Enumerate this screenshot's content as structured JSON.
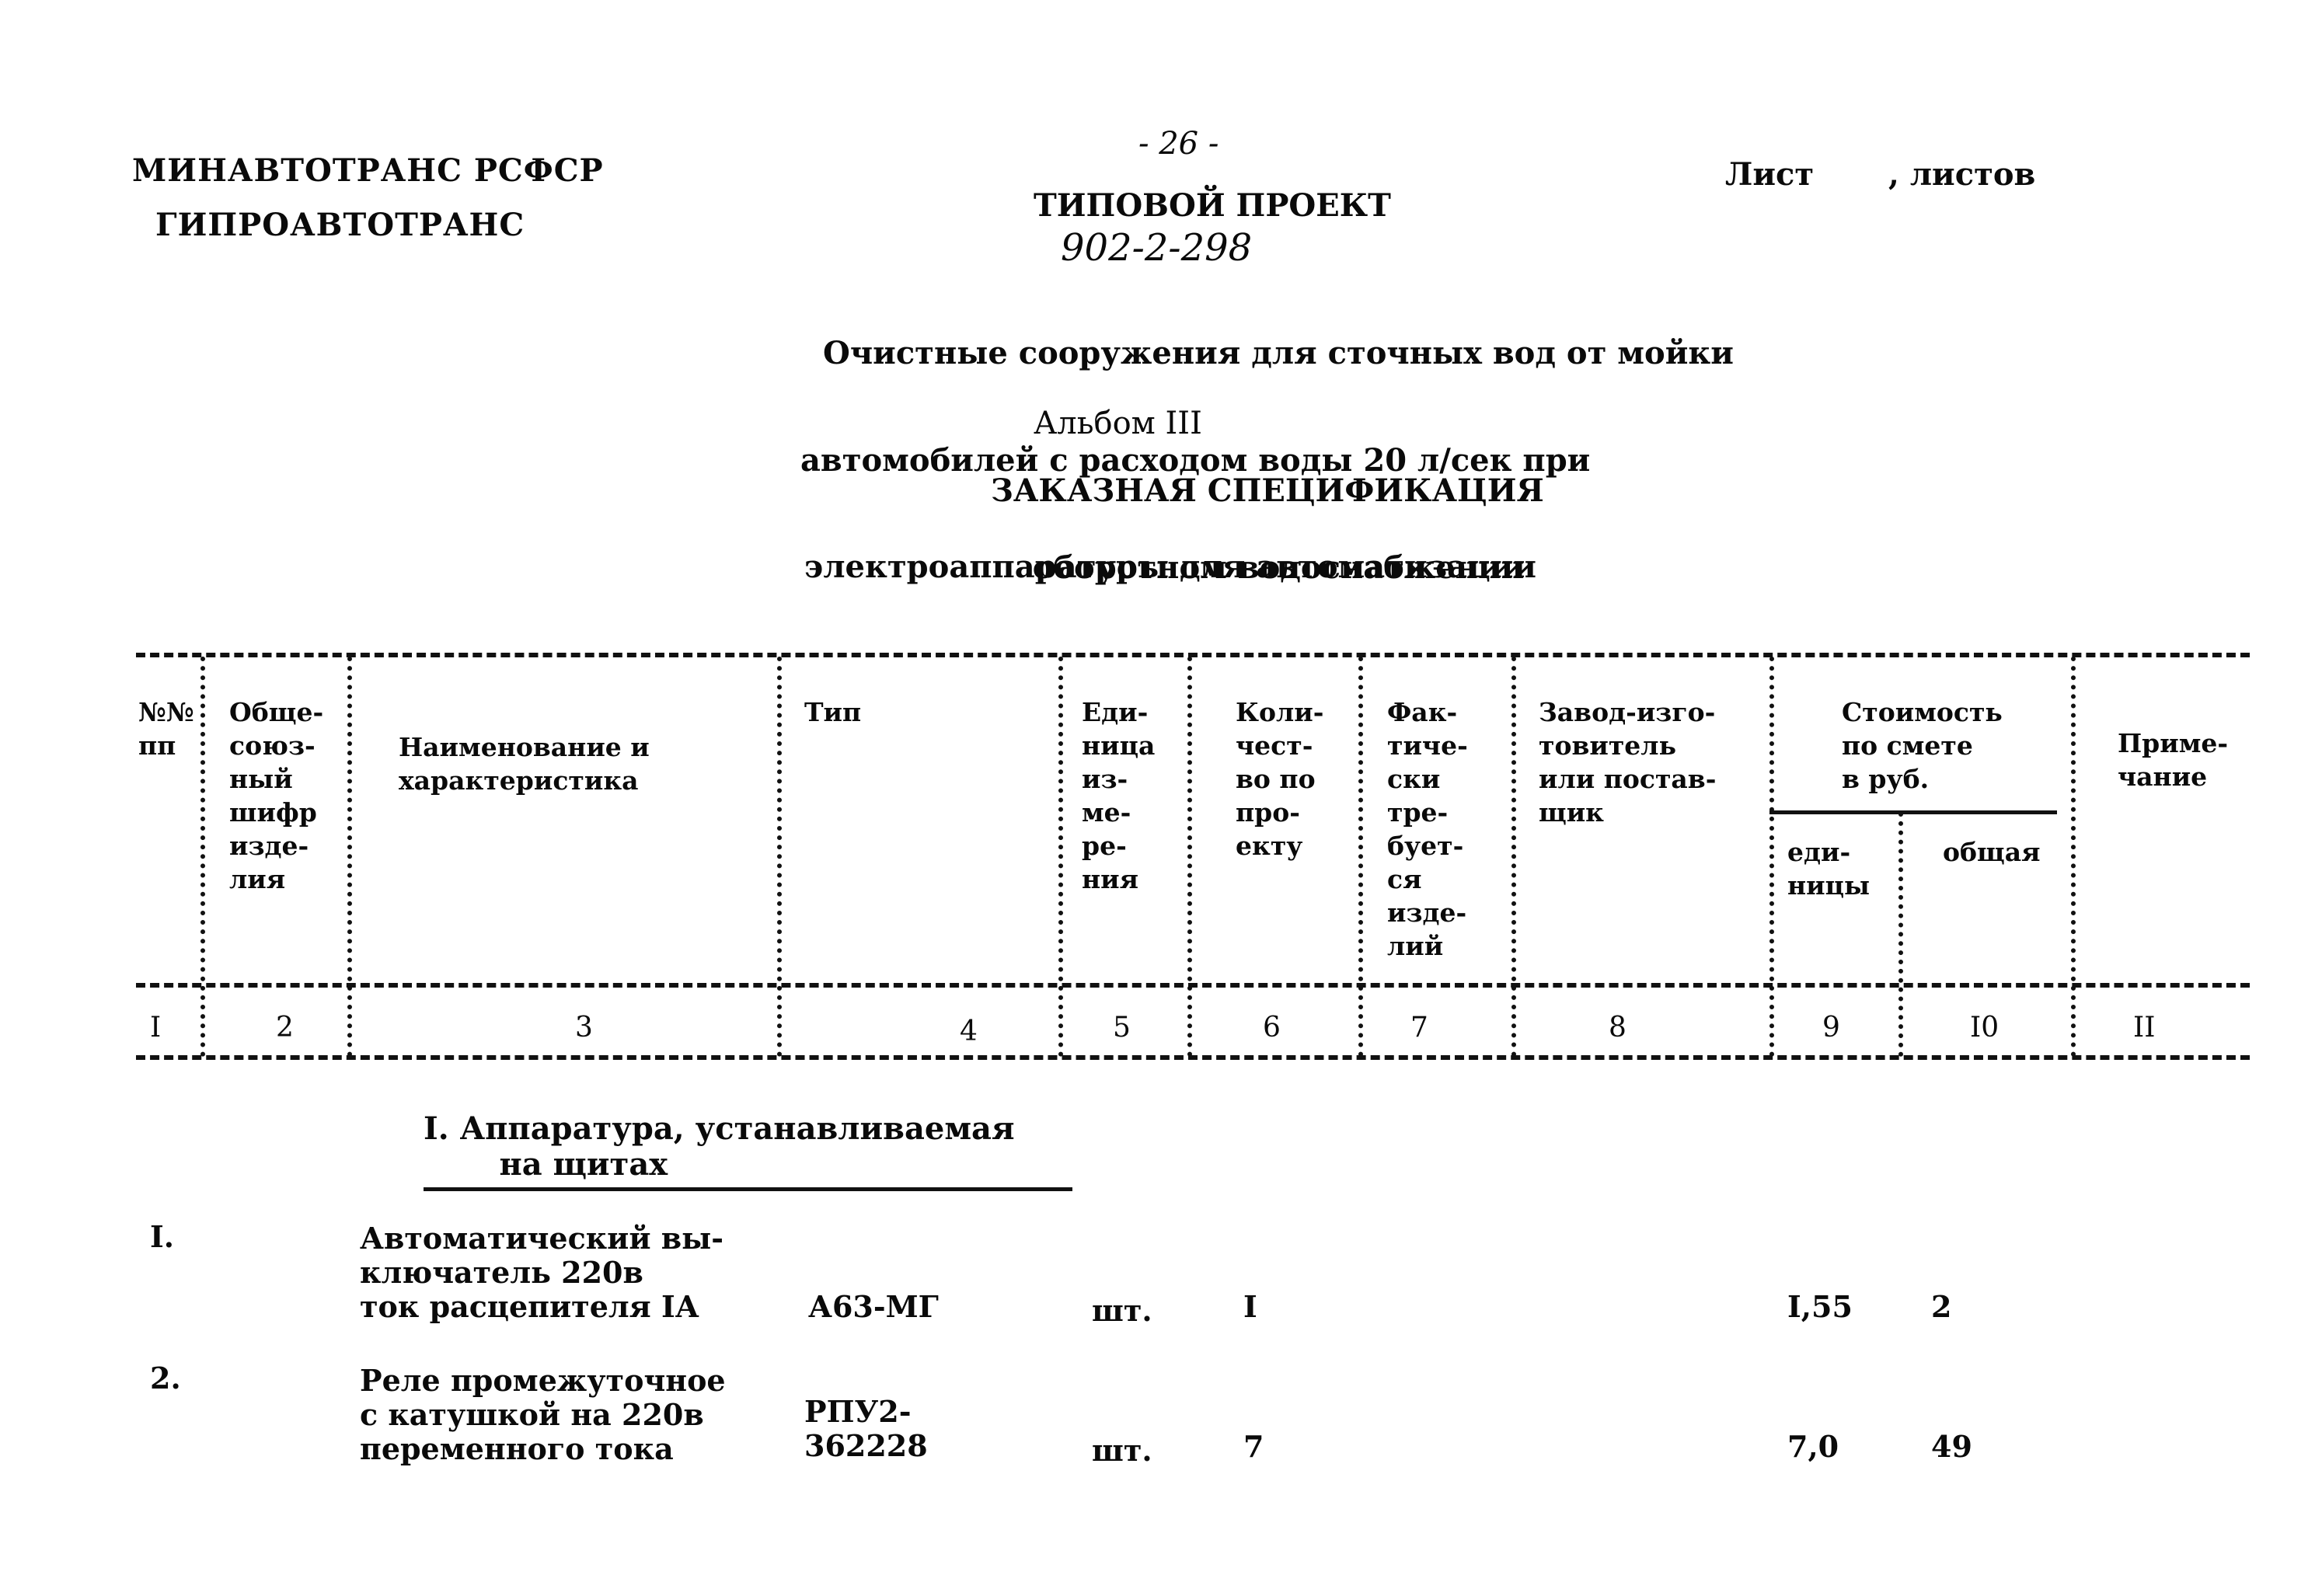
{
  "header": {
    "org_line1": "МИНАВТОТРАНС РСФСР",
    "org_line2": "ГИПРОАВТОТРАНС",
    "page_number": "- 26 -",
    "sheet_label": "Лист",
    "sheets_label": ", листов",
    "project_type": "ТИПОВОЙ ПРОЕКТ",
    "project_number": "902-2-298",
    "description": [
      "Очистные сооружения для сточных вод от мойки",
      "автомобилей с расходом воды 20 л/сек при",
      "оборотном водоснабжении"
    ],
    "album": "Альбом III",
    "doc_title": "ЗАКАЗНАЯ СПЕЦИФИКАЦИЯ",
    "doc_subtitle": "электроаппаратуры для автоматизации"
  },
  "table": {
    "columns": [
      {
        "label": "№№\nпп",
        "number": "I"
      },
      {
        "label": "Обще-\nсоюз-\nный\nшифр\nизде-\nлия",
        "number": "2"
      },
      {
        "label": "Наименование и\nхарактеристика",
        "number": "3"
      },
      {
        "label": "Тип",
        "number": "4"
      },
      {
        "label": "Еди-\nница\nиз-\nме-\nре-\nния",
        "number": "5"
      },
      {
        "label": "Коли-\nчест-\nво по\nпро-\nекту",
        "number": "6"
      },
      {
        "label": "Фак-\nтиче-\nски\nтре-\nбует-\nся\nизде-\nлий",
        "number": "7"
      },
      {
        "label": "Завод-изго-\nтовитель\nили постав-\nщик",
        "number": "8"
      },
      {
        "label": "еди-\nницы",
        "number": "9"
      },
      {
        "label": "общая",
        "number": "I0"
      },
      {
        "label": "Приме-\nчание",
        "number": "II"
      }
    ],
    "cost_group_label": "Стоимость\nпо смете\nв руб.",
    "section_title": "I. Аппаратура, устанавливаемая\n       на щитах",
    "rows": [
      {
        "index": "I.",
        "name": "Автоматический вы-\nключатель 220в\nток расцепителя IА",
        "type": "А63-МГ",
        "unit": "шт.",
        "qty": "I",
        "unit_price": "I,55",
        "total": "2"
      },
      {
        "index": "2.",
        "name": "Реле промежуточное\nс катушкой на 220в\nпеременного тока",
        "type": "РПУ2-\n362228",
        "unit": "шт.",
        "qty": "7",
        "unit_price": "7,0",
        "total": "49"
      }
    ]
  }
}
